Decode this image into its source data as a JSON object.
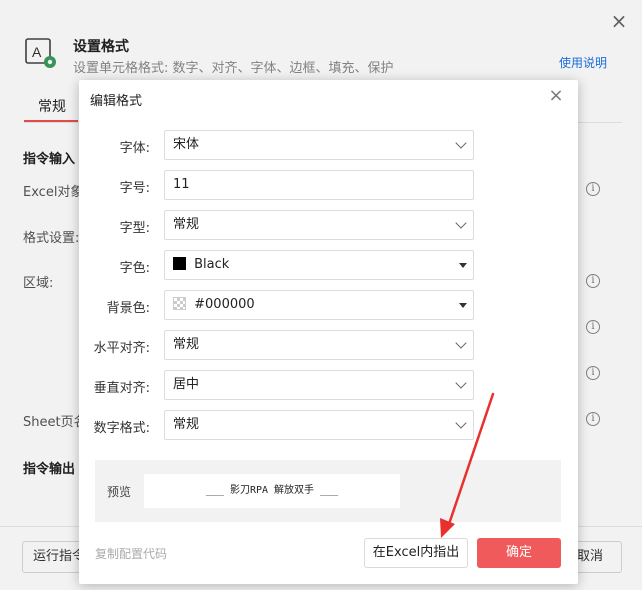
{
  "background": {
    "title": "设置格式",
    "subtitle": "设置单元格格式: 数字、对齐、字体、边框、填充、保护",
    "help_link": "使用说明",
    "tab_label": "常规",
    "section_input": "指令输入",
    "label_excel": "Excel对象",
    "label_format": "格式设置:",
    "label_range": "区域:",
    "label_sheet": "Sheet页名",
    "section_output": "指令输出",
    "run_button": "运行指令",
    "cancel_button": "取消"
  },
  "modal": {
    "title": "编辑格式",
    "fields": {
      "font": {
        "label": "字体:",
        "value": "宋体"
      },
      "size": {
        "label": "字号:",
        "value": "11"
      },
      "style": {
        "label": "字型:",
        "value": "常规"
      },
      "color": {
        "label": "字色:",
        "value": "Black"
      },
      "bgcolor": {
        "label": "背景色:",
        "value": "#000000"
      },
      "halign": {
        "label": "水平对齐:",
        "value": "常规"
      },
      "valign": {
        "label": "垂直对齐:",
        "value": "居中"
      },
      "numfmt": {
        "label": "数字格式:",
        "value": "常规"
      }
    },
    "preview_label": "预览",
    "preview_text": "___ 影刀RPA 解放双手 ___",
    "copy_link": "复制配置代码",
    "locate_button": "在Excel内指出",
    "ok_button": "确定"
  },
  "colors": {
    "accent": "#f05a5a",
    "link": "#1a73e8",
    "arrow": "#e8312f"
  }
}
